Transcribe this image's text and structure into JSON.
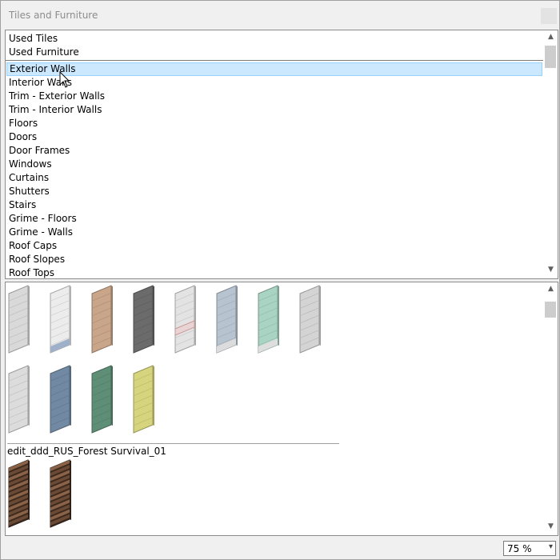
{
  "window": {
    "title": "Tiles and Furniture"
  },
  "categories": {
    "used": [
      "Used Tiles",
      "Used Furniture"
    ],
    "items": [
      "Exterior Walls",
      "Interior Walls",
      "Trim - Exterior Walls",
      "Trim - Interior Walls",
      "Floors",
      "Doors",
      "Door Frames",
      "Windows",
      "Curtains",
      "Shutters",
      "Stairs",
      "Grime - Floors",
      "Grime - Walls",
      "Roof Caps",
      "Roof Slopes",
      "Roof Tops"
    ],
    "selected": "Exterior Walls"
  },
  "tiles": {
    "row1": [
      {
        "name": "white-brick-wall-tile",
        "color": "#d9d9d9",
        "accent": "#d9d9d9"
      },
      {
        "name": "white-blue-base-wall-tile",
        "color": "#ececec",
        "accent": "#9fb1c8"
      },
      {
        "name": "tan-stucco-wall-tile",
        "color": "#c9a58a",
        "accent": "#c9a58a"
      },
      {
        "name": "dark-gray-brick-wall-tile",
        "color": "#6b6b6b",
        "accent": "#6b6b6b"
      },
      {
        "name": "white-patterned-band-wall-tile",
        "color": "#e3e3e3",
        "accent": "#c48a8a"
      },
      {
        "name": "light-blue-panel-wall-tile",
        "color": "#b7c4cf",
        "accent": "#dcdcdc"
      },
      {
        "name": "mint-panel-wall-tile",
        "color": "#a9d4c3",
        "accent": "#dedede"
      },
      {
        "name": "light-gray-wall-tile",
        "color": "#d4d4d4",
        "accent": "#d4d4d4"
      }
    ],
    "row2": [
      {
        "name": "light-gray-tile-wall",
        "color": "#dcdcdc"
      },
      {
        "name": "steel-blue-wall-tile",
        "color": "#7189a2"
      },
      {
        "name": "green-wall-tile",
        "color": "#5e8f76"
      },
      {
        "name": "yellow-wall-tile",
        "color": "#d6d47c"
      }
    ],
    "set_label": "edit_ddd_RUS_Forest Survival_01",
    "row3": [
      {
        "name": "wooden-log-wall-tile",
        "color": "#3d2a1e"
      },
      {
        "name": "wooden-log-wall-tile",
        "color": "#3d2a1e"
      }
    ]
  },
  "zoom": {
    "value": "75 %"
  }
}
